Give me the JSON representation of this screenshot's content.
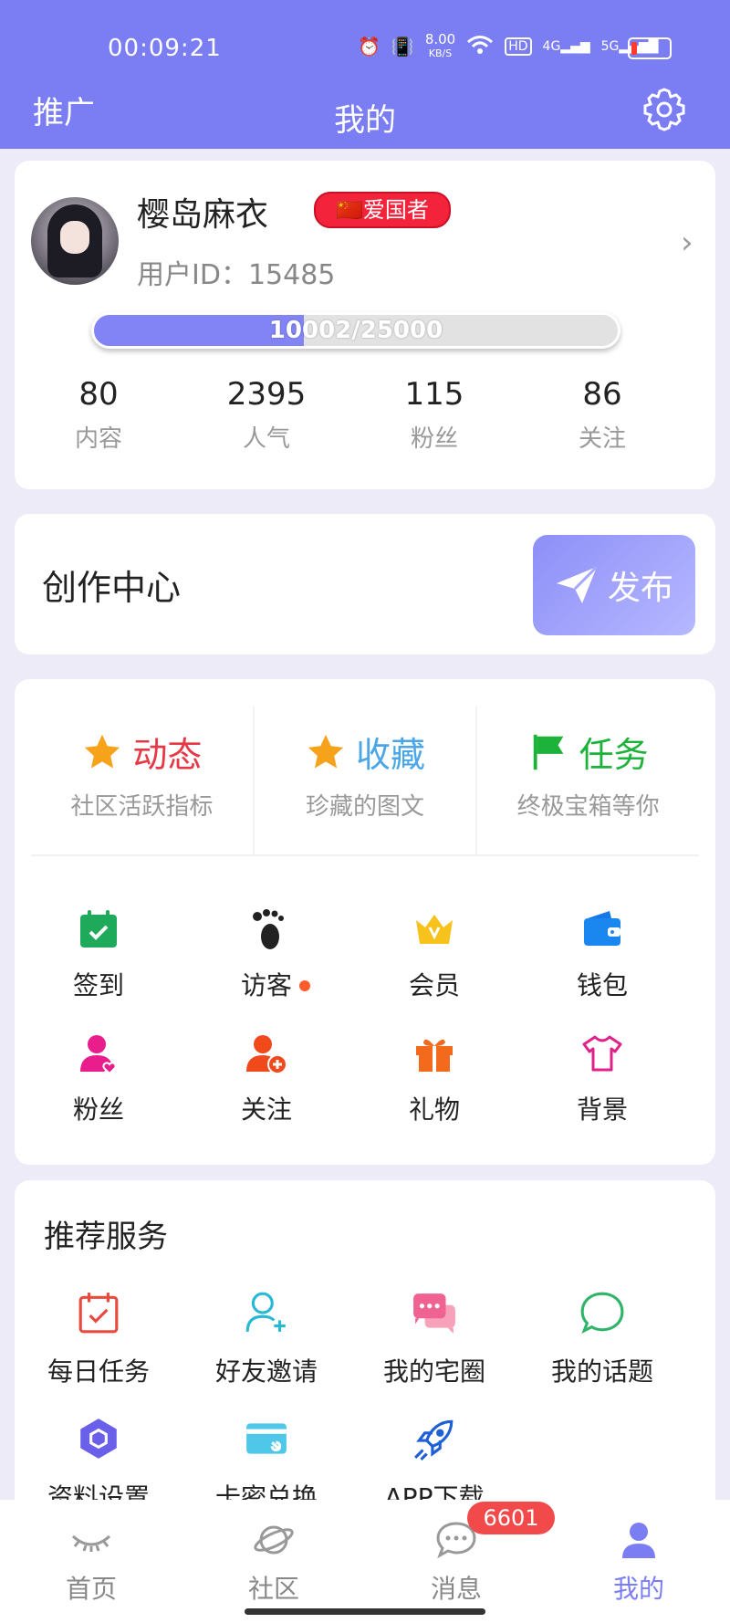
{
  "status": {
    "time": "00:09:21",
    "speed": "8.00",
    "speed_unit": "KB/S",
    "net1": "4G",
    "net2": "5G",
    "battery": "16"
  },
  "header": {
    "left": "推广",
    "title": "我的"
  },
  "profile": {
    "name": "樱岛麻衣",
    "badge": "🇨🇳爱国者",
    "uid": "用户ID：15485",
    "progress_text": "10002/25000",
    "progress_fraction": 0.4,
    "stats": [
      {
        "num": "80",
        "label": "内容"
      },
      {
        "num": "2395",
        "label": "人气"
      },
      {
        "num": "115",
        "label": "粉丝"
      },
      {
        "num": "86",
        "label": "关注"
      }
    ]
  },
  "creation": {
    "title": "创作中心",
    "publish": "发布"
  },
  "features": [
    {
      "title": "动态",
      "sub": "社区活跃指标",
      "color": "#e63946",
      "icon": "star-icon"
    },
    {
      "title": "收藏",
      "sub": "珍藏的图文",
      "color": "#4aa6e6",
      "icon": "star-icon"
    },
    {
      "title": "任务",
      "sub": "终极宝箱等你",
      "color": "#1db33a",
      "icon": "flag-icon"
    }
  ],
  "grid": [
    {
      "label": "签到",
      "icon": "calendar-check-icon"
    },
    {
      "label": "访客",
      "icon": "footprint-icon"
    },
    {
      "label": "会员",
      "icon": "crown-icon"
    },
    {
      "label": "钱包",
      "icon": "wallet-icon"
    },
    {
      "label": "粉丝",
      "icon": "fans-icon"
    },
    {
      "label": "关注",
      "icon": "add-user-icon"
    },
    {
      "label": "礼物",
      "icon": "gift-icon"
    },
    {
      "label": "背景",
      "icon": "shirt-icon"
    }
  ],
  "services": {
    "title": "推荐服务",
    "items": [
      {
        "label": "每日任务",
        "icon": "daily-task-icon"
      },
      {
        "label": "好友邀请",
        "icon": "invite-icon"
      },
      {
        "label": "我的宅圈",
        "icon": "chat-bubbles-icon"
      },
      {
        "label": "我的话题",
        "icon": "topic-bubble-icon"
      },
      {
        "label": "资料设置",
        "icon": "settings-hex-icon"
      },
      {
        "label": "卡密兑换",
        "icon": "card-icon"
      },
      {
        "label": "APP下载",
        "icon": "rocket-icon"
      }
    ]
  },
  "tabs": [
    {
      "label": "首页",
      "icon": "eye-lash-icon"
    },
    {
      "label": "社区",
      "icon": "planet-icon"
    },
    {
      "label": "消息",
      "icon": "message-icon",
      "badge": "6601"
    },
    {
      "label": "我的",
      "icon": "user-icon",
      "active": true
    }
  ]
}
